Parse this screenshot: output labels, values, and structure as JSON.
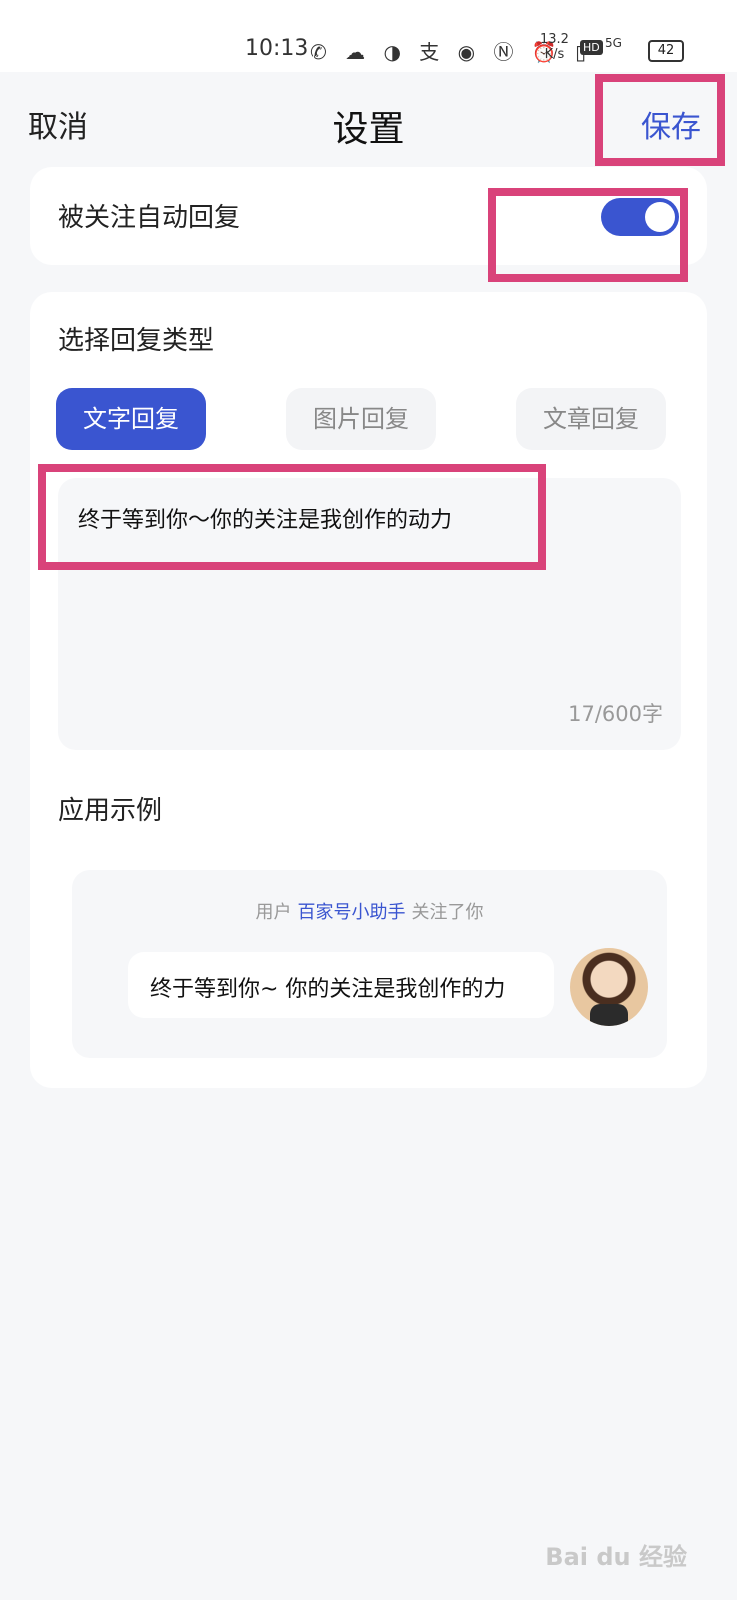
{
  "status_bar": {
    "time": "10:13",
    "icons": "✆ ☁ ◑ 支 ◉ Ⓝ ⏰ ▯",
    "speed": "13.2\nK/s",
    "hd": "HD",
    "signal": "5G",
    "battery": "42"
  },
  "header": {
    "cancel": "取消",
    "title": "设置",
    "save": "保存"
  },
  "follow_reply": {
    "label": "被关注自动回复",
    "enabled": true
  },
  "reply_type": {
    "title": "选择回复类型",
    "options": [
      "文字回复",
      "图片回复",
      "文章回复"
    ],
    "selected": "文字回复"
  },
  "reply_text": {
    "value": "终于等到你～你的关注是我创作的动力",
    "counter": "17/600字"
  },
  "example": {
    "title": "应用示例",
    "notice_prefix": "用户",
    "notice_name": "百家号小助手",
    "notice_suffix": "关注了你",
    "bubble": "终于等到你~ 你的关注是我创作的力"
  },
  "colors": {
    "accent": "#3a55d0",
    "highlight": "#d9437a",
    "background": "#f6f7f9"
  },
  "watermark": "Bai du 经验"
}
